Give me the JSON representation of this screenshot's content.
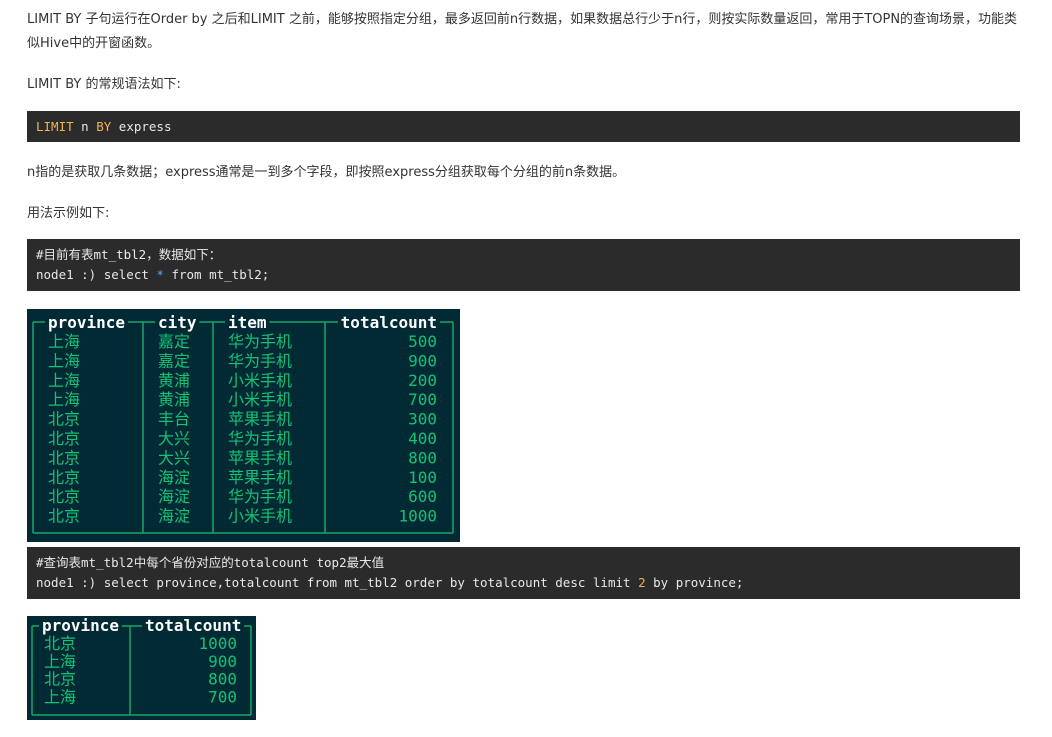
{
  "intro": "LIMIT BY 子句运行在Order by 之后和LIMIT 之前，能够按照指定分组，最多返回前n行数据，如果数据总行少于n行，则按实际数量返回，常用于TOPN的查询场景，功能类似Hive中的开窗函数。",
  "syntax_intro": "LIMIT BY 的常规语法如下:",
  "syntax_code": {
    "kw1": "LIMIT",
    "mid": " n ",
    "kw2": "BY",
    "rest": " express"
  },
  "explain": "n指的是获取几条数据；express通常是一到多个字段，即按照express分组获取每个分组的前n条数据。",
  "usage_intro": "用法示例如下:",
  "code1": {
    "line1": "#目前有表mt_tbl2，数据如下：",
    "line2_a": "node1 :) select ",
    "line2_star": "*",
    "line2_b": " from mt_tbl2;"
  },
  "table1": {
    "headers": [
      "province",
      "city",
      "item",
      "totalcount"
    ],
    "rows": [
      [
        "上海",
        "嘉定",
        "华为手机",
        "500"
      ],
      [
        "上海",
        "嘉定",
        "华为手机",
        "900"
      ],
      [
        "上海",
        "黄浦",
        "小米手机",
        "200"
      ],
      [
        "上海",
        "黄浦",
        "小米手机",
        "700"
      ],
      [
        "北京",
        "丰台",
        "苹果手机",
        "300"
      ],
      [
        "北京",
        "大兴",
        "华为手机",
        "400"
      ],
      [
        "北京",
        "大兴",
        "苹果手机",
        "800"
      ],
      [
        "北京",
        "海淀",
        "苹果手机",
        "100"
      ],
      [
        "北京",
        "海淀",
        "华为手机",
        "600"
      ],
      [
        "北京",
        "海淀",
        "小米手机",
        "1000"
      ]
    ]
  },
  "code2": {
    "line1": "#查询表mt_tbl2中每个省份对应的totalcount top2最大值",
    "line2_a": "node1 :) select province,totalcount from mt_tbl2 order by totalcount desc limit ",
    "line2_num": "2",
    "line2_b": " by province;"
  },
  "table2": {
    "headers": [
      "province",
      "totalcount"
    ],
    "rows": [
      [
        "北京",
        "1000"
      ],
      [
        "上海",
        "900"
      ],
      [
        "北京",
        "800"
      ],
      [
        "上海",
        "700"
      ]
    ]
  },
  "colors": {
    "terminal_bg": "#022a35",
    "terminal_text": "#13c274",
    "terminal_header": "#ffffff",
    "code_bg": "#2b2b2b",
    "keyword": "#f0b44c"
  }
}
